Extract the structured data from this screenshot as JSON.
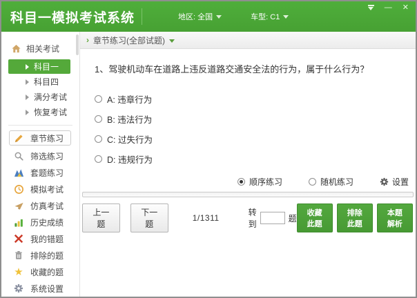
{
  "window": {
    "title": "科目一模拟考试系统",
    "region_label": "地区: 全国",
    "car_type_label": "车型: C1",
    "controls": {
      "minimize_label": "—",
      "close_label": "✕"
    }
  },
  "sidebar": {
    "section_title": "相关考试",
    "exam_items": [
      {
        "label": "科目一",
        "active": true
      },
      {
        "label": "科目四",
        "active": false
      },
      {
        "label": "满分考试",
        "active": false
      },
      {
        "label": "恢复考试",
        "active": false
      }
    ],
    "menu_items": [
      {
        "label": "章节练习",
        "icon": "pencil-icon",
        "active": true
      },
      {
        "label": "筛选练习",
        "icon": "search-icon",
        "active": false
      },
      {
        "label": "套题练习",
        "icon": "chart-icon",
        "active": false
      },
      {
        "label": "模拟考试",
        "icon": "clock-icon",
        "active": false
      },
      {
        "label": "仿真考试",
        "icon": "paper-icon",
        "active": false
      },
      {
        "label": "历史成绩",
        "icon": "bars-icon",
        "active": false
      },
      {
        "label": "我的错题",
        "icon": "red-x-icon",
        "active": false
      },
      {
        "label": "排除的题",
        "icon": "trash-icon",
        "active": false
      },
      {
        "label": "收藏的题",
        "icon": "star-icon",
        "active": false
      },
      {
        "label": "系统设置",
        "icon": "gear-icon",
        "active": false
      }
    ]
  },
  "breadcrumb": {
    "label": "章节练习(全部试题)"
  },
  "question": {
    "text": "1、驾驶机动车在道路上违反道路交通安全法的行为，属于什么行为？",
    "options": [
      {
        "label": "A: 违章行为",
        "selected": false
      },
      {
        "label": "B: 违法行为",
        "selected": false
      },
      {
        "label": "C: 过失行为",
        "selected": false
      },
      {
        "label": "D: 违规行为",
        "selected": false
      }
    ]
  },
  "practice_mode": {
    "sequential_label": "顺序练习",
    "random_label": "随机练习",
    "settings_label": "设置",
    "selected": "顺序练习"
  },
  "pager": {
    "prev_label": "上一题",
    "next_label": "下一题",
    "progress": "1/1311",
    "goto_prefix": "转到",
    "goto_suffix": "题",
    "goto_value": ""
  },
  "actions": {
    "favorite_label": "收藏此题",
    "exclude_label": "排除此题",
    "analysis_label": "本题解析"
  },
  "colors": {
    "header_green": "#4aa735",
    "active_item_green": "#54a93a",
    "button_green": "#4a9e38"
  }
}
